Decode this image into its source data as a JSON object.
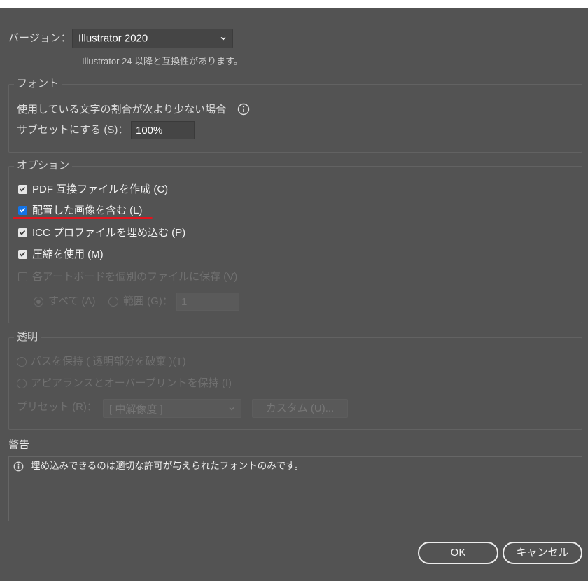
{
  "colors": {
    "background": "#535353",
    "accent": "#1473e6",
    "annotation": "#e3141e"
  },
  "version": {
    "label": "バージョン：",
    "selected": "Illustrator 2020",
    "compat_note": "Illustrator 24 以降と互換性があります。",
    "icon": "chevron-down-icon"
  },
  "font_section": {
    "legend": "フォント",
    "subset_description": "使用している文字の割合が次より少ない場合",
    "info_icon": "info-icon",
    "subset_label": "サブセットにする (S)：",
    "subset_value": "100%"
  },
  "options_section": {
    "legend": "オプション",
    "pdf_compatible": {
      "label": "PDF 互換ファイルを作成 (C)",
      "checked": true,
      "enabled": true
    },
    "include_linked_images": {
      "label": "配置した画像を含む (L)",
      "checked": true,
      "enabled": true,
      "focused": true
    },
    "embed_icc": {
      "label": "ICC プロファイルを埋め込む (P)",
      "checked": true,
      "enabled": true
    },
    "use_compression": {
      "label": "圧縮を使用 (M)",
      "checked": true,
      "enabled": true
    },
    "save_artboards": {
      "label": "各アートボードを個別のファイルに保存 (V)",
      "checked": false,
      "enabled": false
    },
    "range_mode": {
      "all_label": "すべて (A)",
      "all_selected": true,
      "range_label": "範囲 (G)：",
      "range_selected": false,
      "range_value": "1",
      "enabled": false
    }
  },
  "transparency_section": {
    "legend": "透明",
    "preserve_paths": {
      "label": "パスを保持 ( 透明部分を破棄 )(T)",
      "selected": false,
      "enabled": false
    },
    "preserve_appearance": {
      "label": "アピアランスとオーバープリントを保持 (I)",
      "selected": false,
      "enabled": false
    },
    "preset_label": "プリセット (R)：",
    "preset_value": "[ 中解像度 ]",
    "custom_button": "カスタム (U)...",
    "enabled": false
  },
  "warnings": {
    "label": "警告",
    "info_icon": "info-icon",
    "messages": [
      "埋め込みできるのは適切な許可が与えられたフォントのみです。"
    ]
  },
  "buttons": {
    "ok": "OK",
    "cancel": "キャンセル"
  }
}
